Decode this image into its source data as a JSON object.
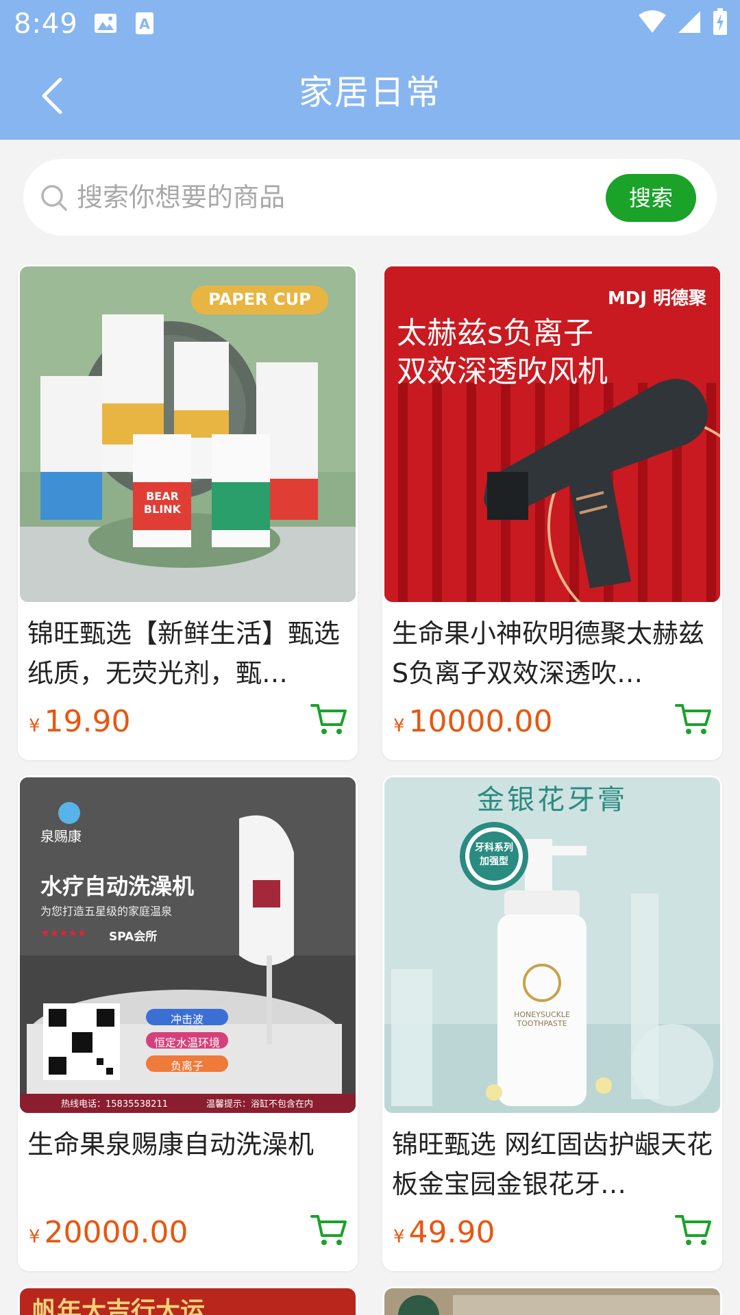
{
  "status": {
    "time": "8:49"
  },
  "header": {
    "title": "家居日常"
  },
  "search": {
    "placeholder": "搜索你想要的商品",
    "button_label": "搜索"
  },
  "currency_symbol": "¥",
  "products": [
    {
      "title": "锦旺甄选【新鲜生活】甄选纸质，无荧光剂，甄…",
      "price": "19.90",
      "image": {
        "badge": "PAPER CUP",
        "cup_text": "BEAR BLINK"
      }
    },
    {
      "title": "生命果小神砍明德聚太赫兹S负离子双效深透吹…",
      "price": "10000.00",
      "image": {
        "brand": "MDJ 明德聚",
        "line1": "太赫兹s负离子",
        "line2": "双效深透吹风机"
      }
    },
    {
      "title": "生命果泉赐康自动洗澡机",
      "price": "20000.00",
      "image": {
        "brand": "泉赐康",
        "headline": "水疗自动洗澡机",
        "sub": "为您打造五星级的家庭温泉",
        "spa": "SPA会所",
        "tag1": "冲击波",
        "tag2": "恒定水温环境",
        "tag3": "负离子",
        "hotline": "热线电话：15835538211",
        "tip": "温馨提示：浴缸不包含在内"
      }
    },
    {
      "title": "锦旺甄选 网红固齿护龈天花板金宝园金银花牙…",
      "price": "49.90",
      "image": {
        "headline": "金银花牙膏",
        "seal1": "牙科系列",
        "seal2": "加强型",
        "bottle": "HONEYSUCKLE TOOTHPASTE"
      }
    }
  ],
  "partial": {
    "left_text": "帆年大吉行大运"
  },
  "colors": {
    "header": "#87b5f0",
    "accent_green": "#1aa229",
    "price": "#e8560f"
  }
}
